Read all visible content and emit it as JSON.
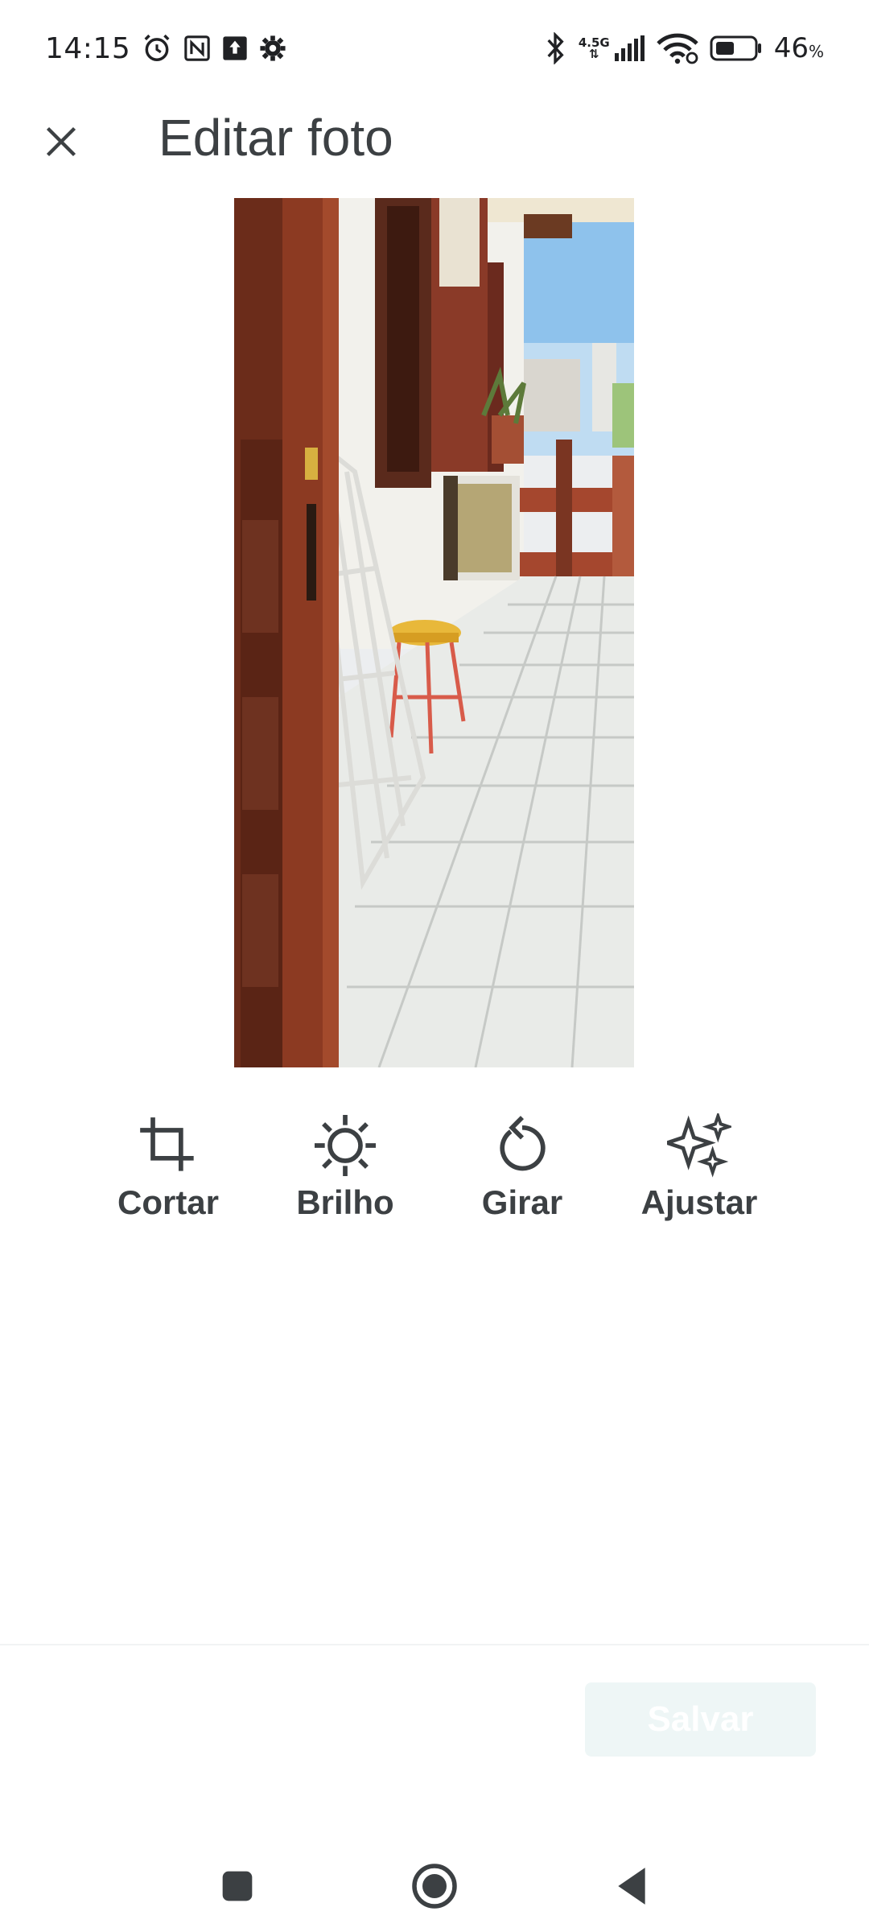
{
  "status_bar": {
    "time": "14:15",
    "network": "4.5G",
    "battery_percent": "46",
    "battery_unit": "%",
    "icons": [
      "alarm-icon",
      "nfc-icon",
      "upload-icon",
      "settings-icon",
      "bluetooth-icon",
      "signal-icon",
      "wifi-icon",
      "battery-icon"
    ]
  },
  "header": {
    "title": "Editar foto",
    "close_icon": "close-icon"
  },
  "tools": [
    {
      "label": "Cortar",
      "icon": "crop-icon"
    },
    {
      "label": "Brilho",
      "icon": "brightness-icon"
    },
    {
      "label": "Girar",
      "icon": "rotate-icon"
    },
    {
      "label": "Ajustar",
      "icon": "sparkle-icon"
    }
  ],
  "actions": {
    "save_label": "Salvar"
  },
  "nav": {
    "icons": [
      "recents-icon",
      "home-icon",
      "back-icon"
    ]
  },
  "colors": {
    "text": "#3c4043",
    "save_bg": "#eef6f6",
    "save_text": "#ffffff"
  }
}
